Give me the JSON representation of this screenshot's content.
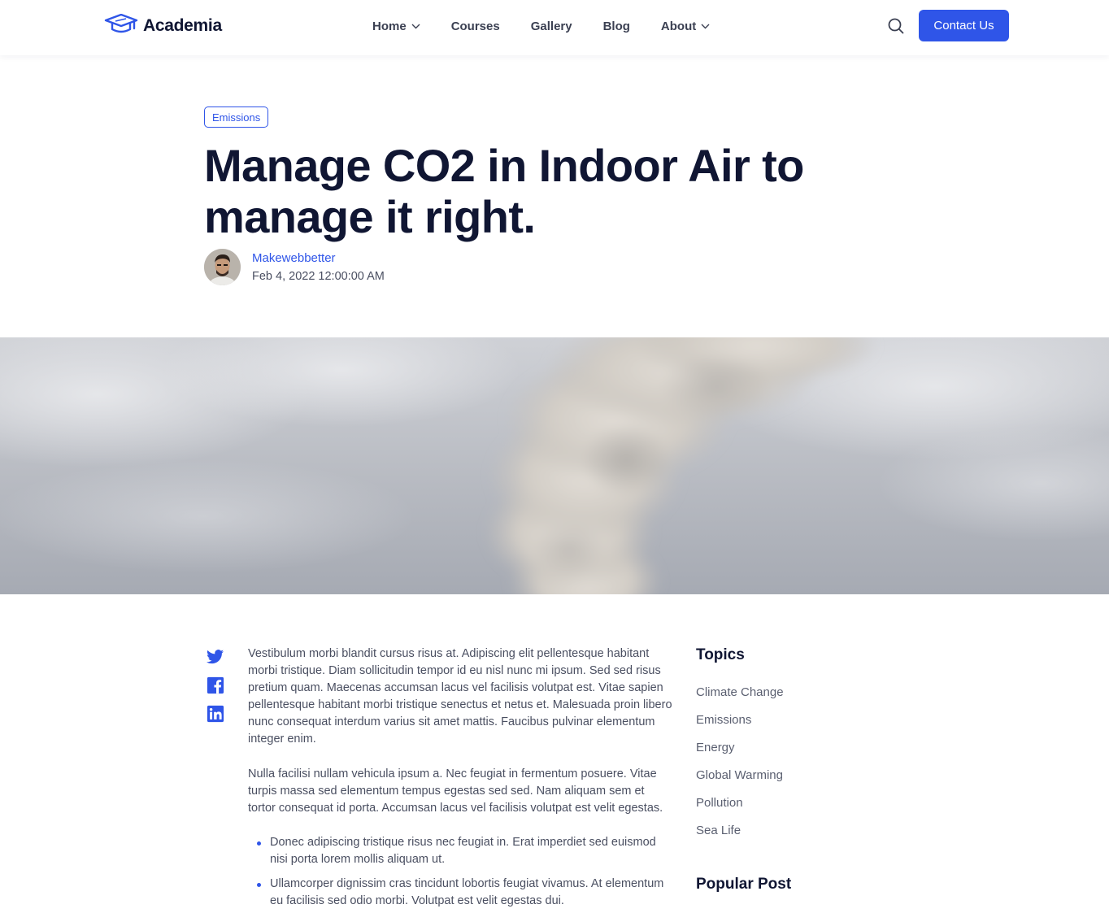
{
  "header": {
    "brand": "Academia",
    "nav": [
      {
        "label": "Home",
        "has_dropdown": true
      },
      {
        "label": "Courses",
        "has_dropdown": false
      },
      {
        "label": "Gallery",
        "has_dropdown": false
      },
      {
        "label": "Blog",
        "has_dropdown": false
      },
      {
        "label": "About",
        "has_dropdown": true
      }
    ],
    "contact_label": "Contact Us",
    "icons": {
      "logo": "graduation-cap-icon",
      "search": "search-icon",
      "dropdown": "chevron-down-icon"
    }
  },
  "post": {
    "tag": "Emissions",
    "title": "Manage CO2 in Indoor Air to manage it right.",
    "author": "Makewebbetter",
    "date": "Feb 4, 2022 12:00:00 AM"
  },
  "social": [
    "twitter-icon",
    "facebook-icon",
    "linkedin-icon"
  ],
  "article": {
    "paragraphs": [
      "Vestibulum morbi blandit cursus risus at. Adipiscing elit pellentesque habitant morbi tristique. Diam sollicitudin tempor id eu nisl nunc mi ipsum. Sed sed risus pretium quam. Maecenas accumsan lacus vel facilisis volutpat est. Vitae sapien pellentesque habitant morbi tristique senectus et netus et. Malesuada proin libero nunc consequat interdum varius sit amet mattis. Faucibus pulvinar elementum integer enim.",
      "Nulla facilisi nullam vehicula ipsum a. Nec feugiat in fermentum posuere. Vitae turpis massa sed elementum tempus egestas sed sed. Nam aliquam sem et tortor consequat id porta. Accumsan lacus vel facilisis volutpat est velit egestas."
    ],
    "bullets": [
      "Donec adipiscing tristique risus nec feugiat in. Erat imperdiet sed euismod nisi porta lorem mollis aliquam ut.",
      "Ullamcorper dignissim cras tincidunt lobortis feugiat vivamus. At elementum eu facilisis sed odio morbi. Volutpat est velit egestas dui."
    ]
  },
  "sidebar": {
    "topics_heading": "Topics",
    "topics": [
      "Climate Change",
      "Emissions",
      "Energy",
      "Global Warming",
      "Pollution",
      "Sea Life"
    ],
    "popular_heading": "Popular Post"
  },
  "colors": {
    "accent": "#2f55e8",
    "heading": "#101633",
    "body_text": "#4a4f61"
  }
}
